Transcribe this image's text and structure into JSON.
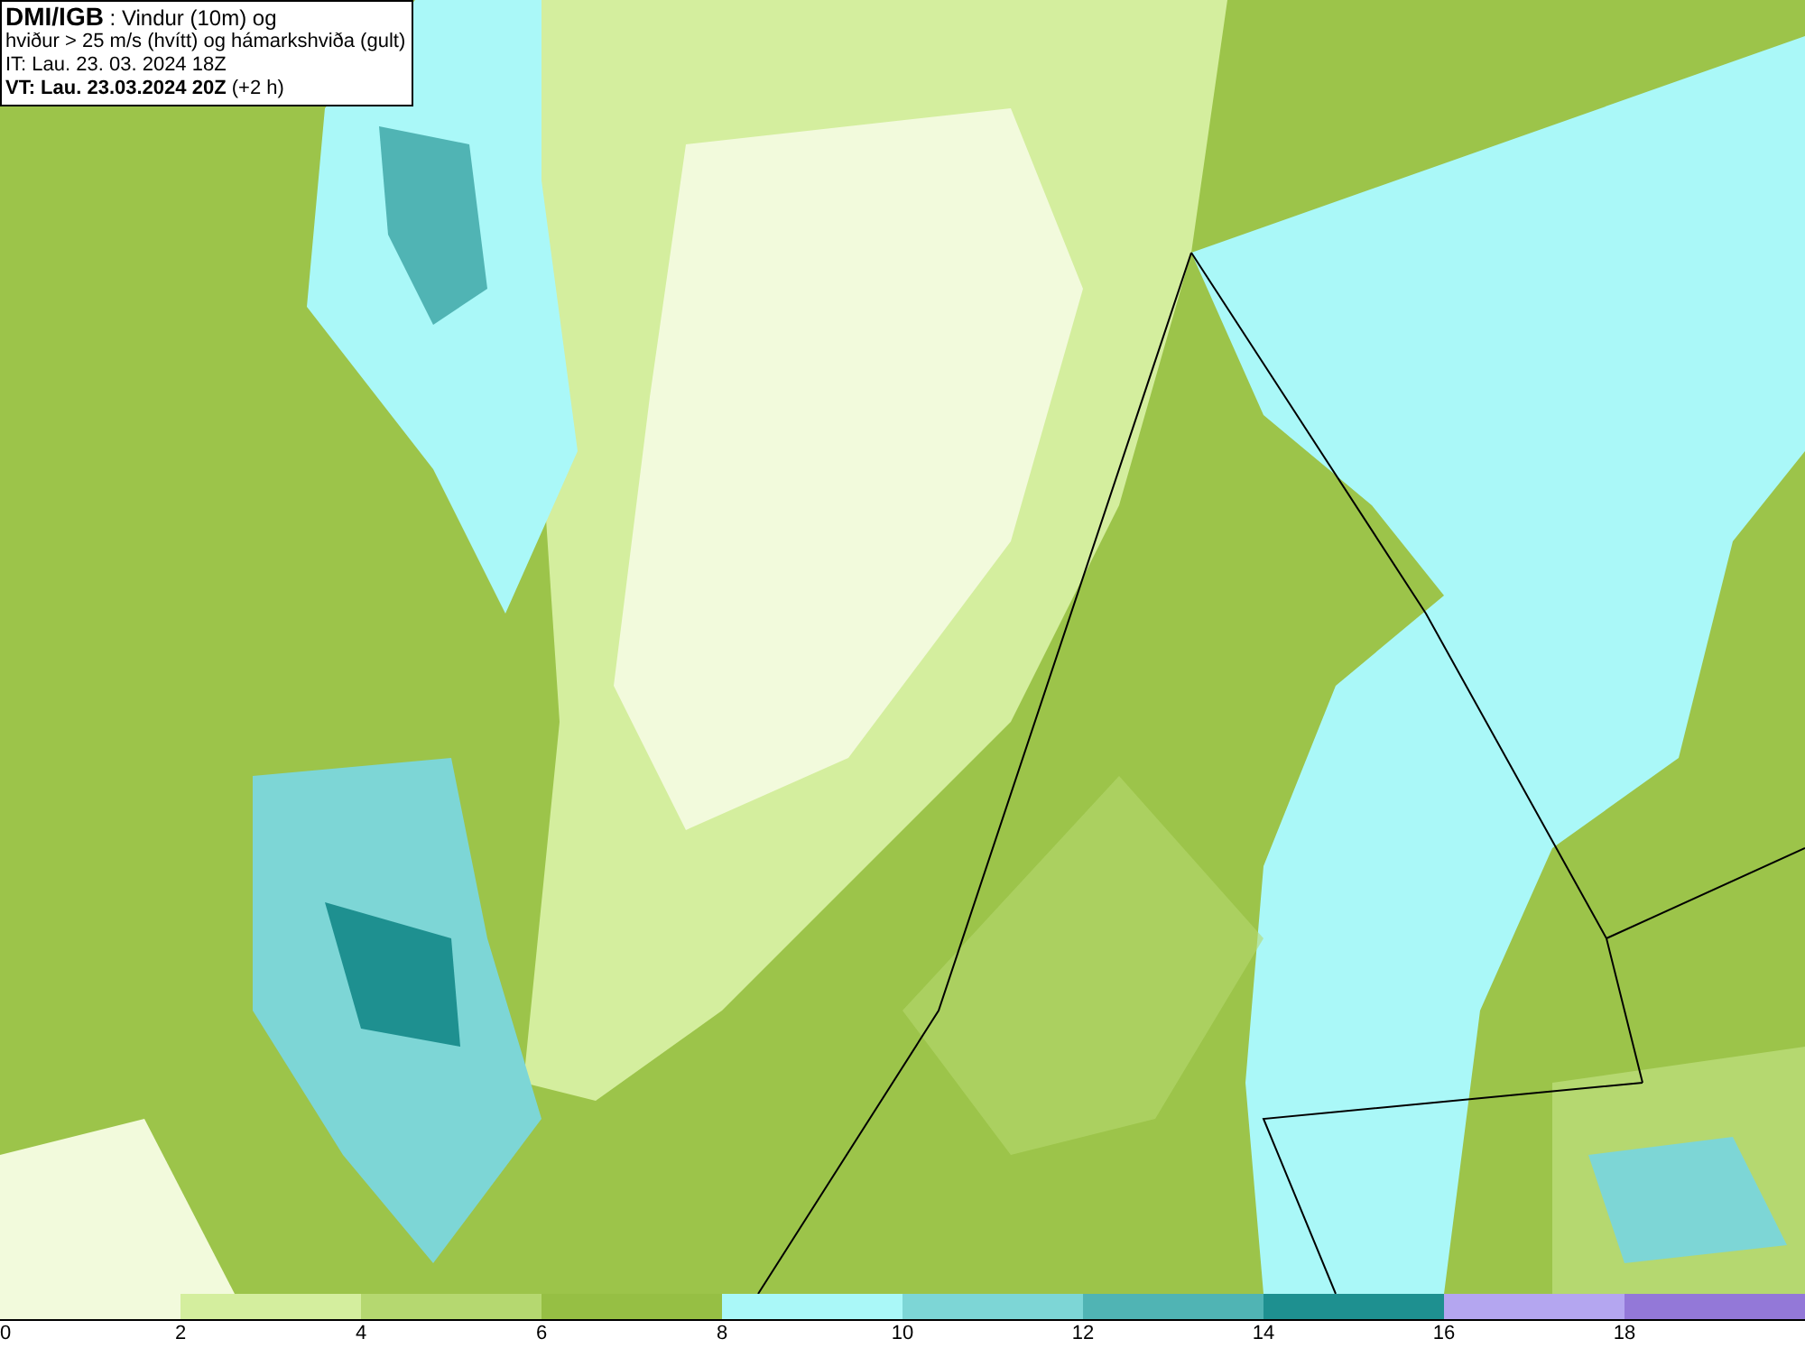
{
  "title_box": {
    "lines": [
      "**DMI/IGB** : Vindur (10m) og",
      "hviður > 25 m/s (hvítt) og hámarkshviða (gult)",
      "IT: Lau. 23. 03. 2024 18Z",
      "**VT: Lau. 23.03.2024 20Z** (+2 h)"
    ]
  },
  "legend": {
    "segments": [
      {
        "color": "#f2fadc"
      },
      {
        "color": "#d4ee9e"
      },
      {
        "color": "#b5d870"
      },
      {
        "color": "#96bf44"
      },
      {
        "color": "#aaf8f8"
      },
      {
        "color": "#7dd6d6"
      },
      {
        "color": "#50b4b4"
      },
      {
        "color": "#1e9090"
      },
      {
        "color": "#b4a6f0"
      },
      {
        "color": "#9378d8"
      }
    ],
    "ticks": [
      "0",
      "2",
      "4",
      "6",
      "8",
      "10",
      "12",
      "14",
      "16",
      "18"
    ]
  }
}
